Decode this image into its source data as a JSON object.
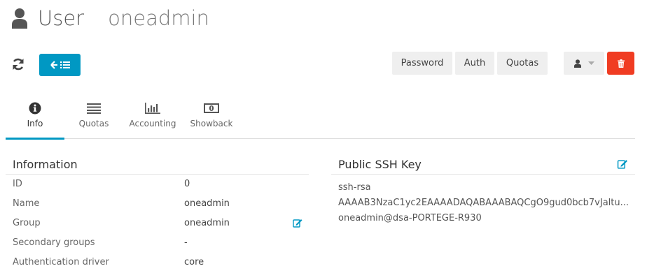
{
  "header": {
    "title": "User",
    "name": "oneadmin"
  },
  "toolbar": {
    "password_label": "Password",
    "auth_label": "Auth",
    "quotas_label": "Quotas",
    "accent": "#0098c3",
    "danger": "#f03c22"
  },
  "tabs": [
    {
      "label": "Info",
      "icon": "info-circle-icon",
      "active": true
    },
    {
      "label": "Quotas",
      "icon": "align-justify-icon",
      "active": false
    },
    {
      "label": "Accounting",
      "icon": "bar-chart-icon",
      "active": false
    },
    {
      "label": "Showback",
      "icon": "money-icon",
      "active": false
    }
  ],
  "information": {
    "heading": "Information",
    "rows": [
      {
        "label": "ID",
        "value": "0"
      },
      {
        "label": "Name",
        "value": "oneadmin"
      },
      {
        "label": "Group",
        "value": "oneadmin"
      },
      {
        "label": "Secondary groups",
        "value": "-"
      },
      {
        "label": "Authentication driver",
        "value": "core"
      }
    ]
  },
  "ssh": {
    "heading": "Public SSH Key",
    "lines": [
      "ssh-rsa",
      "AAAAB3NzaC1yc2EAAAADAQABAAABAQCgO9gud0bcb7vJaltu...",
      "oneadmin@dsa-PORTEGE-R930"
    ]
  }
}
